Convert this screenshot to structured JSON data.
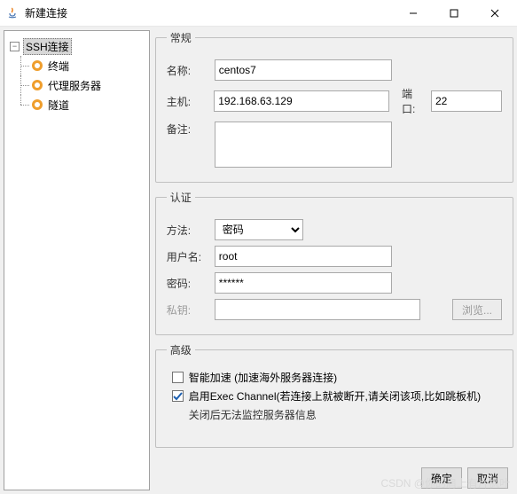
{
  "window": {
    "title": "新建连接"
  },
  "tree": {
    "root": "SSH连接",
    "items": [
      "终端",
      "代理服务器",
      "隧道"
    ]
  },
  "general": {
    "legend": "常规",
    "name_label": "名称:",
    "name_value": "centos7",
    "host_label": "主机:",
    "host_value": "192.168.63.129",
    "port_label": "端口:",
    "port_value": "22",
    "remark_label": "备注:",
    "remark_value": ""
  },
  "auth": {
    "legend": "认证",
    "method_label": "方法:",
    "method_value": "密码",
    "user_label": "用户名:",
    "user_value": "root",
    "pass_label": "密码:",
    "pass_value": "******",
    "key_label": "私钥:",
    "key_value": "",
    "browse_label": "浏览..."
  },
  "advanced": {
    "legend": "高级",
    "chk1_label": "智能加速 (加速海外服务器连接)",
    "chk1_checked": false,
    "chk2_label": "启用Exec Channel(若连接上就被断开,请关闭该项,比如跳板机)",
    "chk2_checked": true,
    "note": "关闭后无法监控服务器信息"
  },
  "buttons": {
    "ok": "确定",
    "cancel": "取消"
  },
  "watermark": "CSDN @你的肩上有片枫叶"
}
